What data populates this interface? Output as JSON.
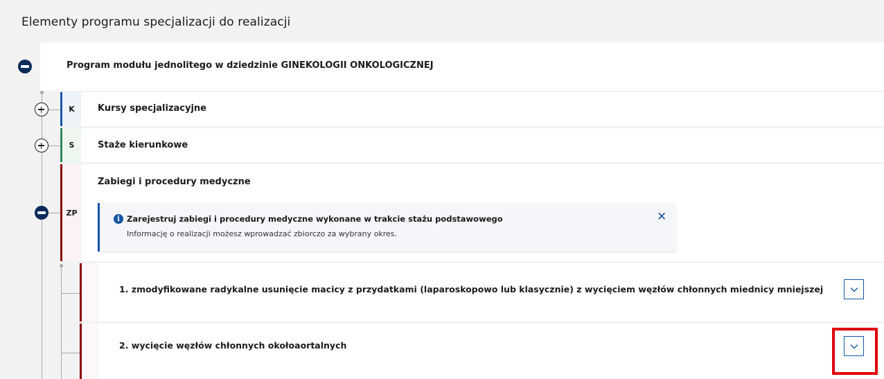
{
  "section_title": "Elementy programu specjalizacji do realizacji",
  "root": {
    "label": "Program modułu jednolitego w dziedzinie GINEKOLOGII ONKOLOGICZNEJ",
    "expanded": true
  },
  "items": [
    {
      "badge": "K",
      "label": "Kursy specjalizacyjne",
      "color": "#1756a5",
      "expanded": false
    },
    {
      "badge": "S",
      "label": "Staże kierunkowe",
      "color": "#2e8b57",
      "expanded": false
    },
    {
      "badge": "ZP",
      "label": "Zabiegi i procedury medyczne",
      "color": "#8b0000",
      "expanded": true
    }
  ],
  "info": {
    "title": "Zarejestruj zabiegi i procedury medyczne wykonane w trakcie stażu podstawowego",
    "text": "Informację o realizacji możesz wprowadzać zbiorczo za wybrany okres.",
    "close_glyph": "✕",
    "icon_glyph": "i"
  },
  "procedures": [
    {
      "label": "1. zmodyfikowane radykalne usunięcie macicy z przydatkami (laparoskopowo lub klasycznie) z wycięciem węzłów chłonnych miednicy mniejszej"
    },
    {
      "label": "2. wycięcie węzłów chłonnych okołoaortalnych"
    }
  ],
  "colors": {
    "accent": "#1756a5",
    "zp": "#8b0000",
    "highlight": "#e0000b",
    "node": "#0b2c5a"
  }
}
